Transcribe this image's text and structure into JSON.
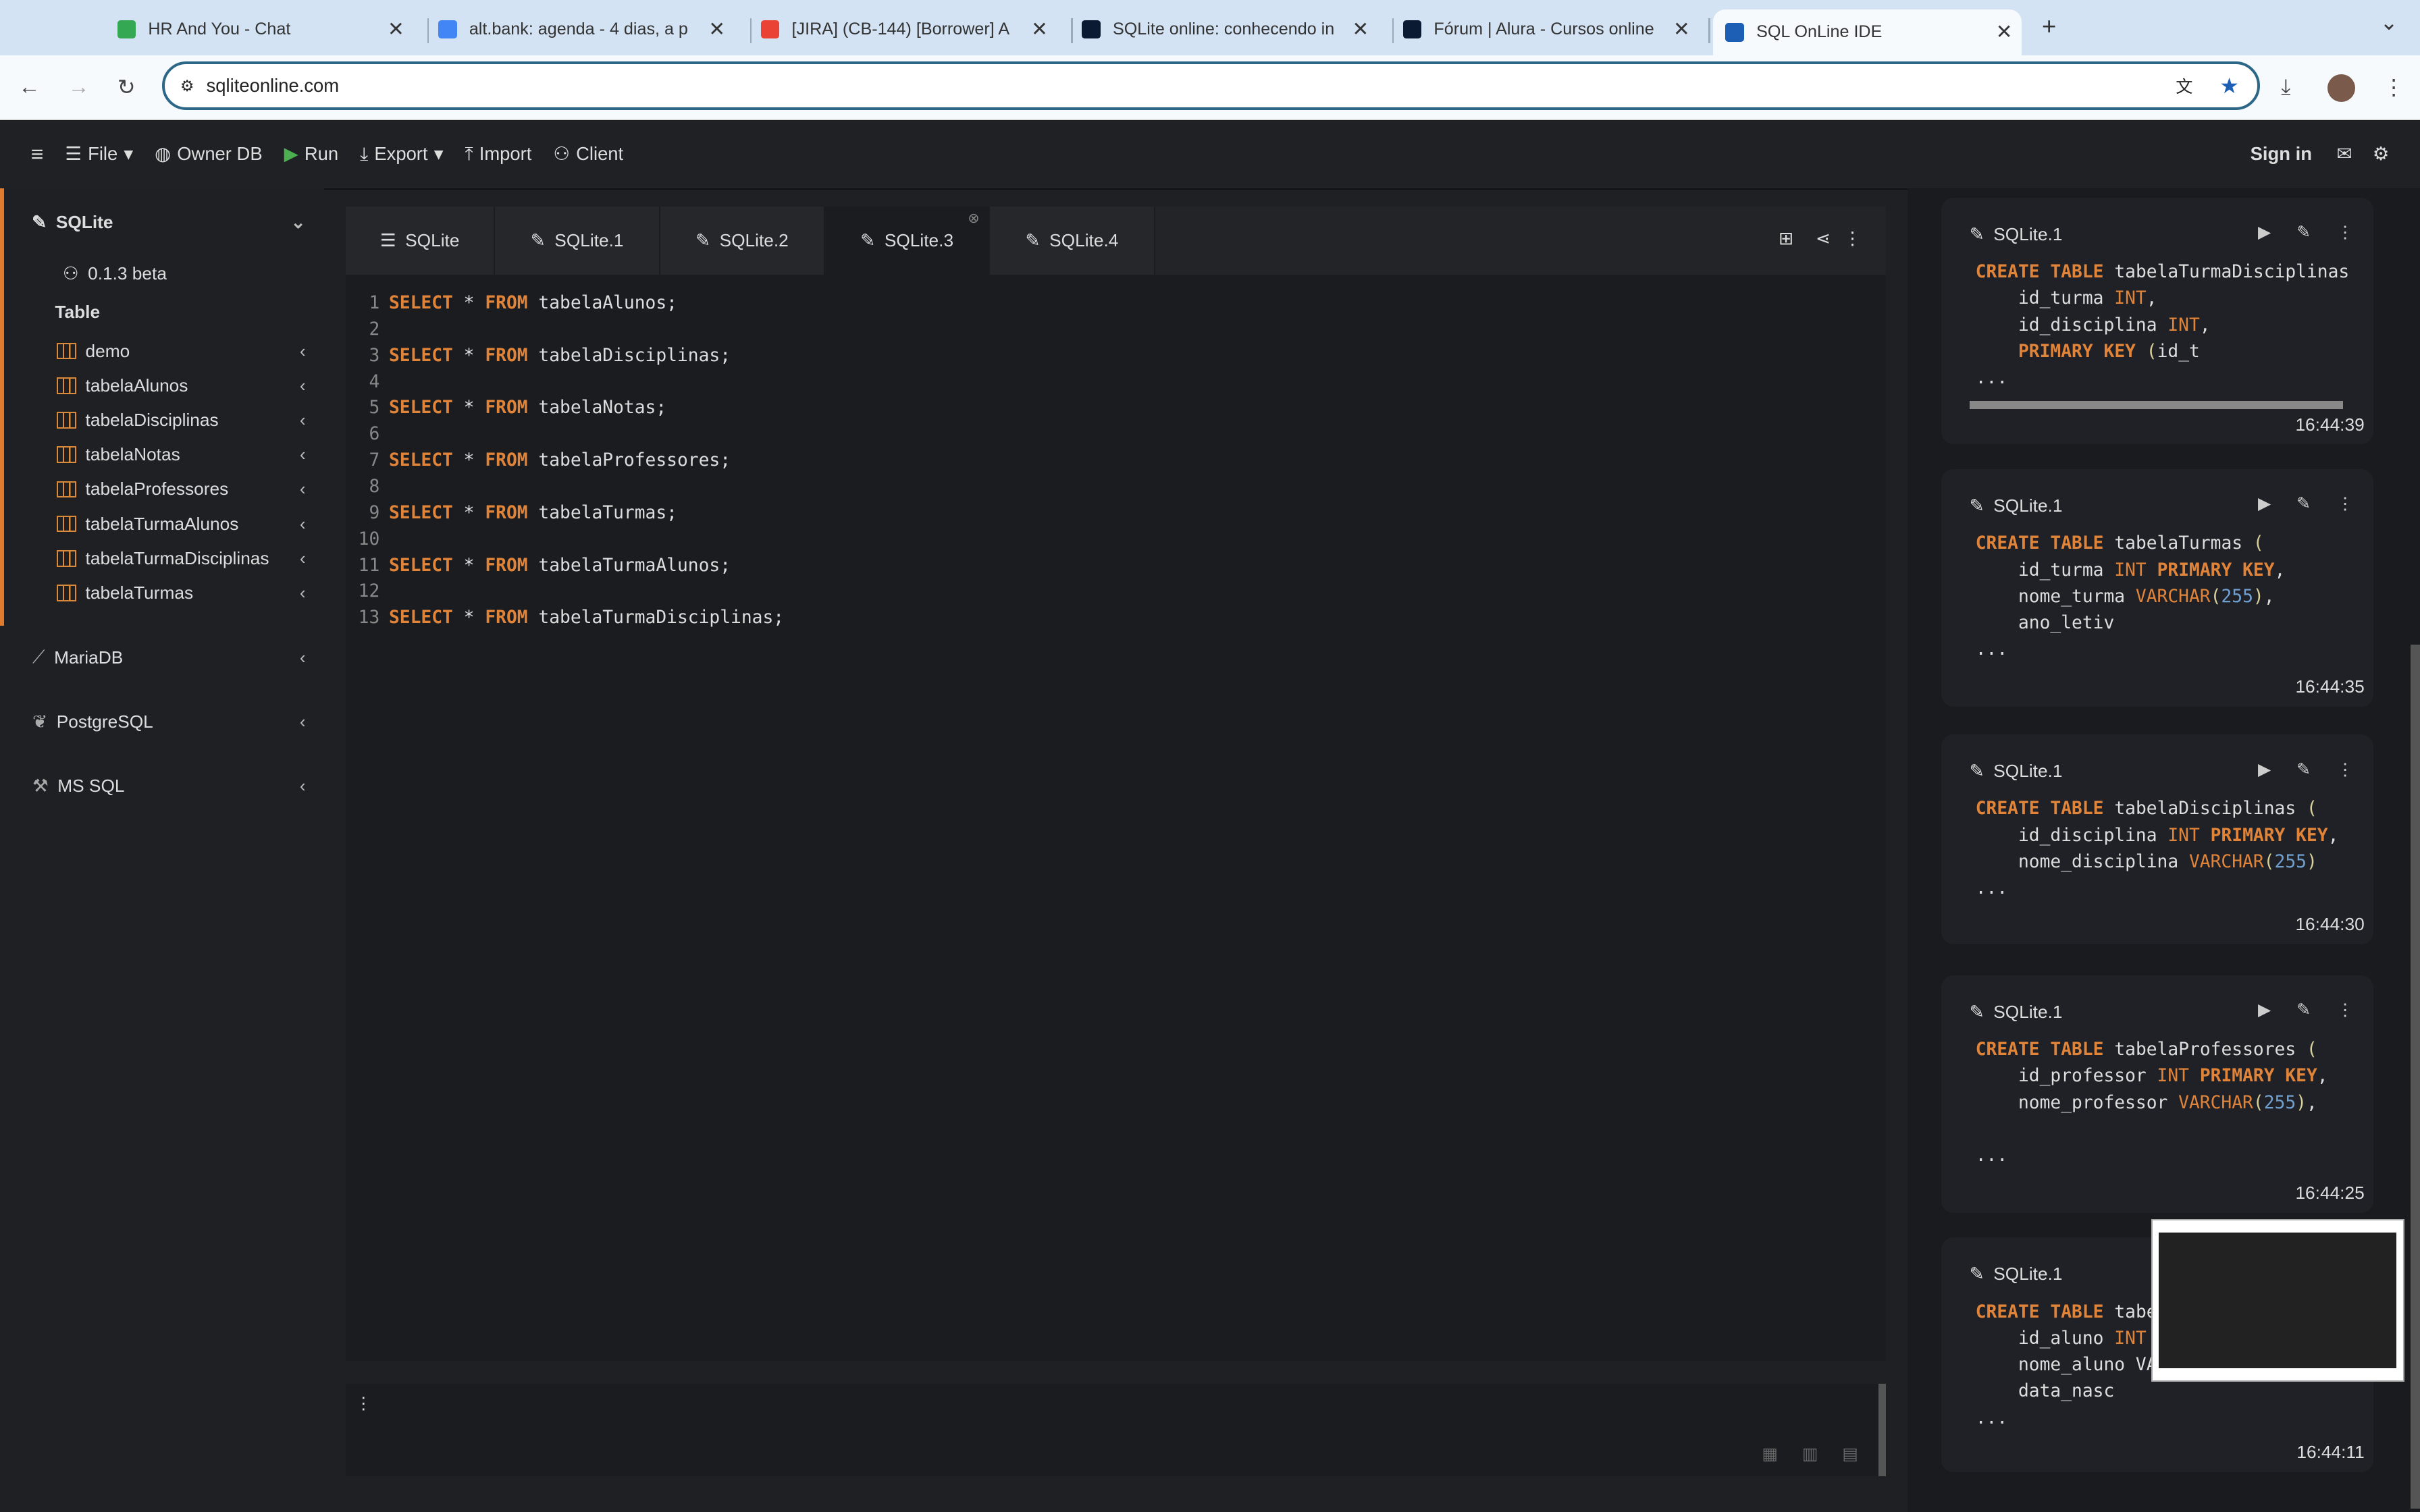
{
  "browser": {
    "tabs": [
      {
        "title": "HR And You - Chat",
        "color": "#34a853"
      },
      {
        "title": "alt.bank: agenda - 4 dias, a p",
        "color": "#4285f4"
      },
      {
        "title": "[JIRA] (CB-144) [Borrower] A",
        "color": "#ea4335"
      },
      {
        "title": "SQLite online: conhecendo in",
        "color": "#0b1a33"
      },
      {
        "title": "Fórum | Alura - Cursos online",
        "color": "#0b1a33"
      },
      {
        "title": "SQL OnLine IDE",
        "color": "#1d5fb4"
      }
    ],
    "url": "sqliteonline.com"
  },
  "toolbar": {
    "file": "File",
    "owner_db": "Owner DB",
    "run": "Run",
    "export": "Export",
    "import": "Import",
    "client": "Client",
    "sign_in": "Sign in"
  },
  "sidebar": {
    "sqlite": "SQLite",
    "version": "0.1.3 beta",
    "table_header": "Table",
    "tables": [
      "demo",
      "tabelaAlunos",
      "tabelaDisciplinas",
      "tabelaNotas",
      "tabelaProfessores",
      "tabelaTurmaAlunos",
      "tabelaTurmaDisciplinas",
      "tabelaTurmas"
    ],
    "dbs": [
      "MariaDB",
      "PostgreSQL",
      "MS SQL"
    ]
  },
  "editor": {
    "tabs": [
      "SQLite",
      "SQLite.1",
      "SQLite.2",
      "SQLite.3",
      "SQLite.4"
    ],
    "active_tab": 3,
    "lines": [
      "SELECT * FROM tabelaAlunos;",
      "",
      "SELECT * FROM tabelaDisciplinas;",
      "",
      "SELECT * FROM tabelaNotas;",
      "",
      "SELECT * FROM tabelaProfessores;",
      "",
      "SELECT * FROM tabelaTurmas;",
      "",
      "SELECT * FROM tabelaTurmaAlunos;",
      "",
      "SELECT * FROM tabelaTurmaDisciplinas;"
    ]
  },
  "history": [
    {
      "db": "SQLite.1",
      "time": "16:44:39",
      "code": "CREATE TABLE tabelaTurmaDisciplinas\n    id_turma INT,\n    id_disciplina INT,\n    PRIMARY KEY (id_t\n..."
    },
    {
      "db": "SQLite.1",
      "time": "16:44:35",
      "code": "CREATE TABLE tabelaTurmas (\n    id_turma INT PRIMARY KEY,\n    nome_turma VARCHAR(255),\n    ano_letiv\n..."
    },
    {
      "db": "SQLite.1",
      "time": "16:44:30",
      "code": "CREATE TABLE tabelaDisciplinas (\n    id_disciplina INT PRIMARY KEY,\n    nome_disciplina VARCHAR(255)\n..."
    },
    {
      "db": "SQLite.1",
      "time": "16:44:25",
      "code": "CREATE TABLE tabelaProfessores (\n    id_professor INT PRIMARY KEY,\n    nome_professor VARCHAR(255),\n\n..."
    },
    {
      "db": "SQLite.1",
      "time": "16:44:11",
      "code": "CREATE TABLE tabe\n    id_aluno INT\n    nome_aluno VA\n    data_nasc\n..."
    }
  ],
  "colors": {
    "accent": "#e07b2e",
    "keyword": "#e0843a",
    "number": "#6fa0d0",
    "run": "#4caf50"
  }
}
